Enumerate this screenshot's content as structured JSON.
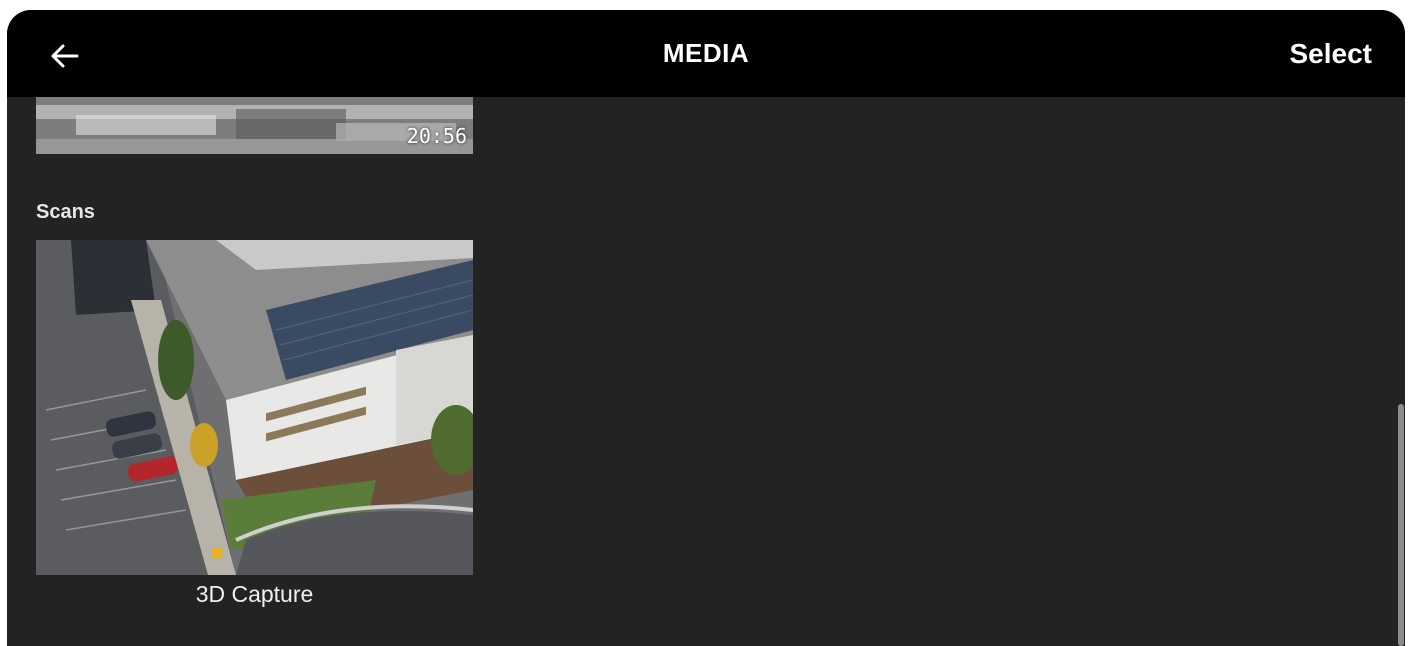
{
  "header": {
    "title": "MEDIA",
    "select_label": "Select",
    "back_icon": "arrow-left-icon"
  },
  "videos": {
    "items": [
      {
        "duration": "20:56"
      }
    ]
  },
  "scans": {
    "section_title": "Scans",
    "items": [
      {
        "label": "3D Capture"
      }
    ]
  },
  "colors": {
    "header_bg": "#000000",
    "content_bg": "#232323",
    "text": "#ffffff"
  }
}
